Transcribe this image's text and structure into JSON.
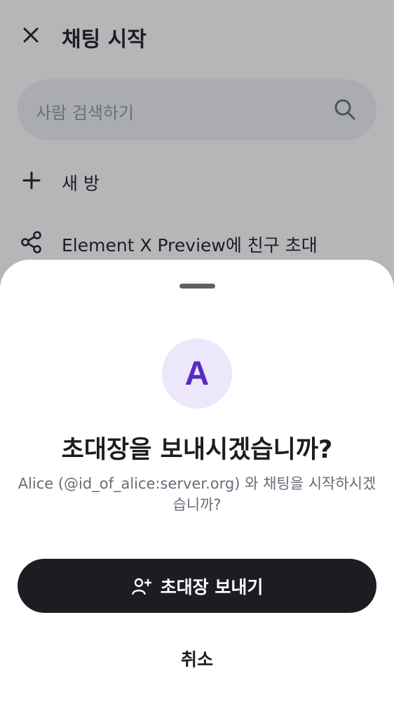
{
  "background_screen": {
    "title": "채팅 시작",
    "close_icon": "close-icon",
    "search": {
      "placeholder": "사람 검색하기",
      "icon": "search-icon"
    },
    "actions": [
      {
        "label": "새 방",
        "icon": "plus-icon"
      },
      {
        "label": "Element X Preview에 친구 초대",
        "icon": "share-icon"
      }
    ]
  },
  "sheet": {
    "avatar_letter": "A",
    "title": "초대장을 보내시겠습니까?",
    "description": "Alice (@id_of_alice:server.org) 와 채팅을 시작하시겠습니까?",
    "primary_button": {
      "label": "초대장 보내기",
      "icon": "add-user-icon"
    },
    "cancel_label": "취소"
  },
  "colors": {
    "scrim": "#1e2026",
    "primary": "#1b1d22",
    "avatar_bg": "#ece7fb",
    "avatar_fg": "#5a2ac4",
    "muted_text": "#656d77"
  }
}
